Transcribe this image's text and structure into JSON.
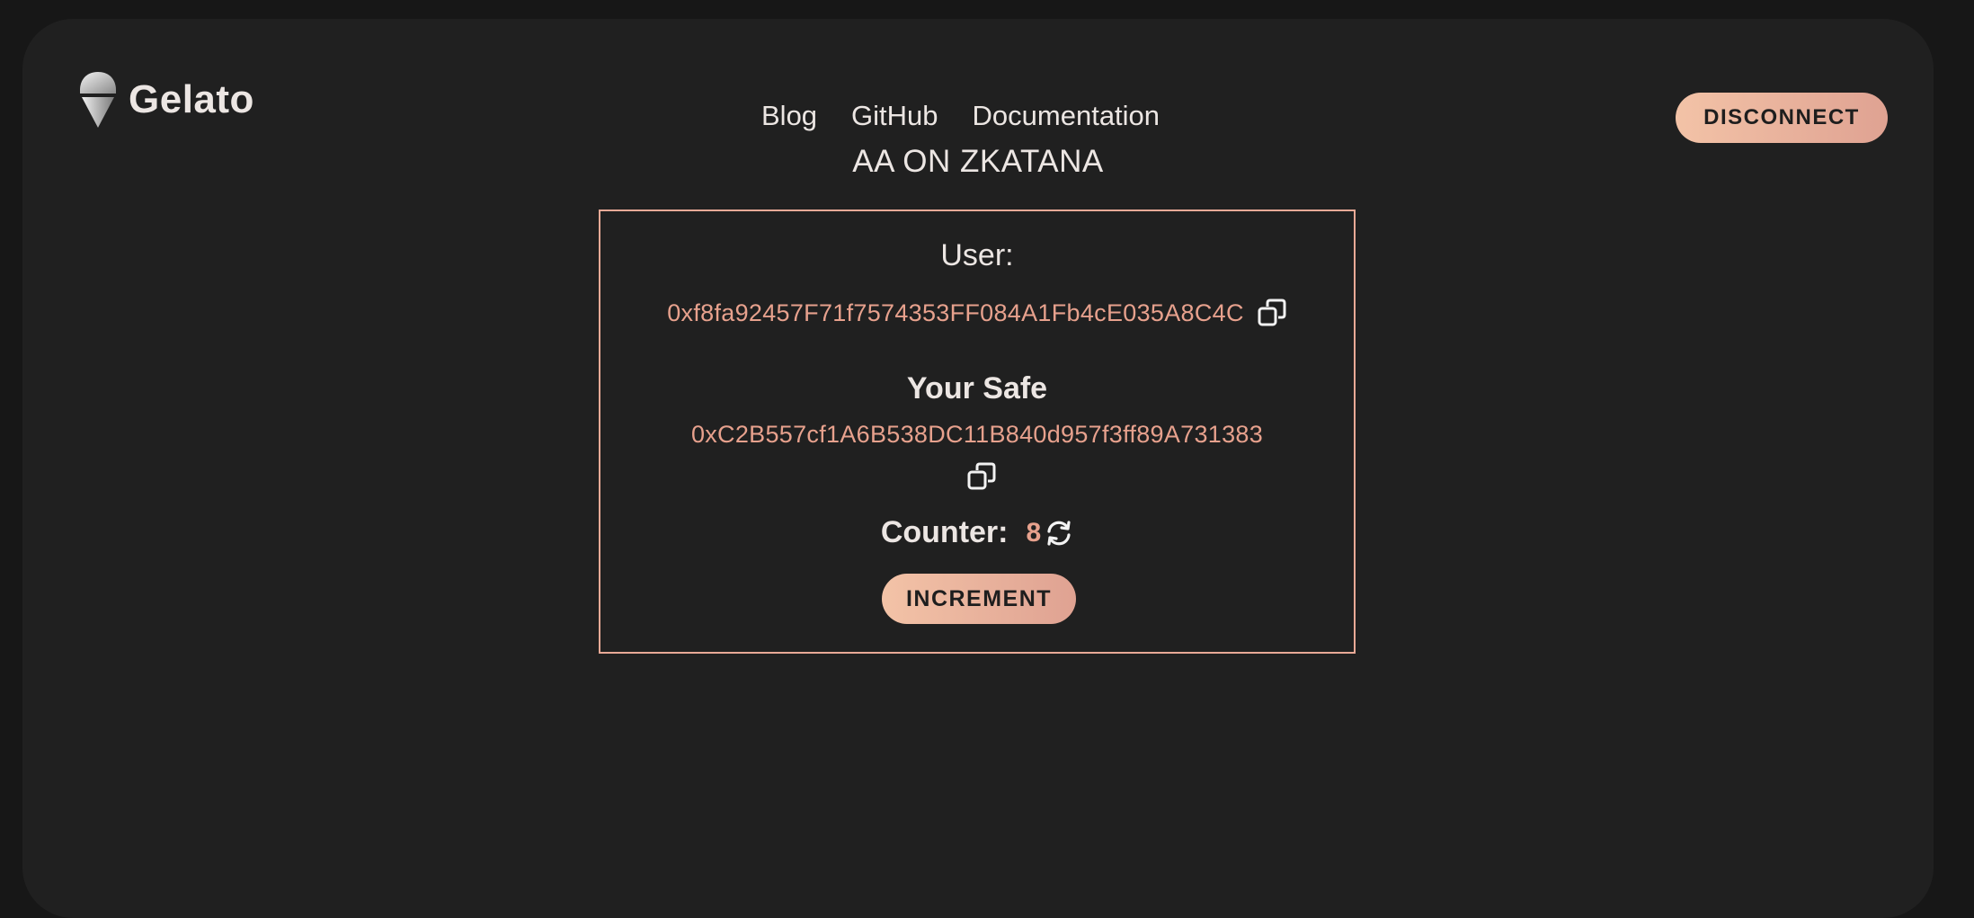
{
  "header": {
    "logo_text": "Gelato",
    "nav": [
      "Blog",
      "GitHub",
      "Documentation"
    ],
    "disconnect_label": "DISCONNECT"
  },
  "heading": "AA ON ZKATANA",
  "card": {
    "user_label": "User:",
    "user_address": "0xf8fa92457F71f7574353FF084A1Fb4cE035A8C4C",
    "safe_label": "Your Safe",
    "safe_address": "0xC2B557cf1A6B538DC11B840d957f3ff89A731383",
    "counter_label": "Counter:",
    "counter_value": "8",
    "increment_label": "INCREMENT"
  },
  "colors": {
    "background": "#202020",
    "accent": "#e7a18d",
    "button_gradient_start": "#f3c3a7",
    "button_gradient_end": "#dfa292",
    "text": "#ece6e3"
  },
  "icons": [
    "gelato-logo-icon",
    "copy-icon",
    "refresh-icon"
  ]
}
